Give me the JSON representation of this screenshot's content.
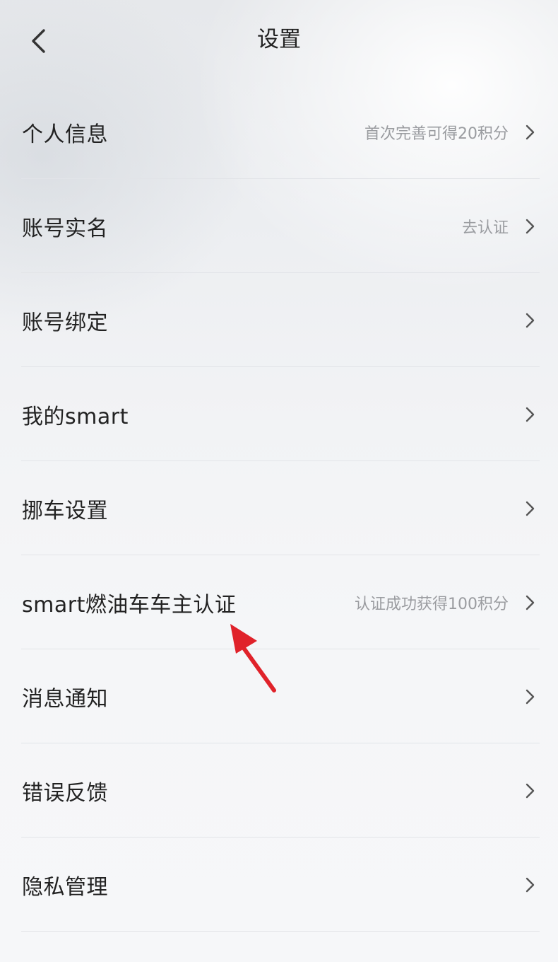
{
  "header": {
    "title": "设置",
    "back_icon": "chevron-left-icon"
  },
  "rows": [
    {
      "id": "personal-info",
      "label": "个人信息",
      "hint": "首次完善可得20积分"
    },
    {
      "id": "account-realname",
      "label": "账号实名",
      "hint": "去认证"
    },
    {
      "id": "account-binding",
      "label": "账号绑定",
      "hint": ""
    },
    {
      "id": "my-smart",
      "label": "我的smart",
      "hint": ""
    },
    {
      "id": "move-car-settings",
      "label": "挪车设置",
      "hint": ""
    },
    {
      "id": "fuel-car-owner-cert",
      "label": "smart燃油车车主认证",
      "hint": "认证成功获得100积分"
    },
    {
      "id": "notifications",
      "label": "消息通知",
      "hint": ""
    },
    {
      "id": "error-feedback",
      "label": "错误反馈",
      "hint": ""
    },
    {
      "id": "privacy-management",
      "label": "隐私管理",
      "hint": ""
    }
  ],
  "colors": {
    "text": "#222222",
    "hint": "#9a9ca0",
    "chevron": "#555555",
    "divider": "#e2e4e8",
    "annotation_arrow": "#e0222a"
  },
  "icons": {
    "row_chevron": "chevron-right-icon",
    "annotation": "red-arrow-icon"
  }
}
